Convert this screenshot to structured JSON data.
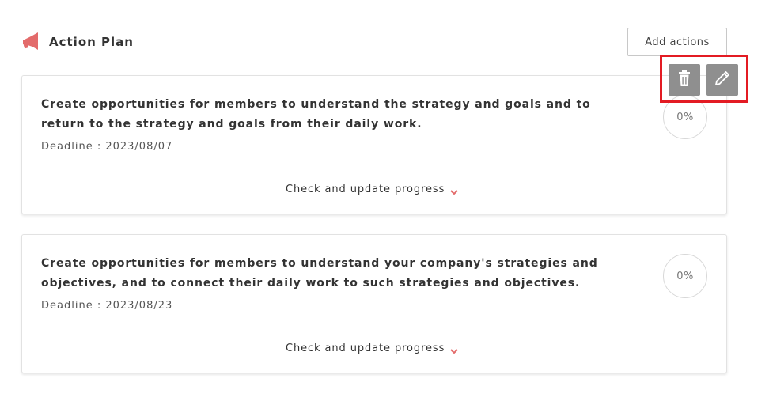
{
  "section": {
    "title": "Action Plan",
    "icon": "megaphone-icon",
    "accent_color": "#e36b6b"
  },
  "toolbar": {
    "add_actions_label": "Add actions",
    "delete_icon": "trash-icon",
    "edit_icon": "pencil-icon",
    "highlight_color": "#e31b23"
  },
  "actions": [
    {
      "text": "Create opportunities for members to understand the strategy and goals and to return to the strategy and goals from their daily work.",
      "deadline": "Deadline : 2023/08/07",
      "progress": "0%",
      "check_label": "Check and update progress"
    },
    {
      "text": "Create opportunities for members to understand your company's strategies and objectives, and to connect their daily work to such strategies and objectives.",
      "deadline": "Deadline : 2023/08/23",
      "progress": "0%",
      "check_label": "Check and update progress"
    }
  ]
}
